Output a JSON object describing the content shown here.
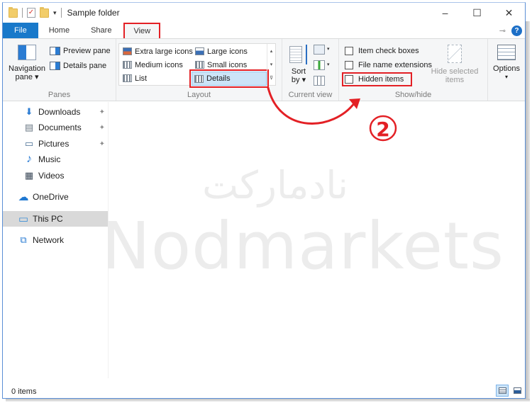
{
  "window": {
    "title": "Sample folder",
    "controls": {
      "minimize": "–",
      "maximize": "☐",
      "close": "✕"
    }
  },
  "quick_access_toolbar": {
    "icons": [
      "folder-icon",
      "properties-icon",
      "new-folder-icon",
      "customize-dropdown-icon"
    ],
    "dropdown_glyph": "▾"
  },
  "tabs": [
    {
      "label": "File",
      "active": false
    },
    {
      "label": "Home",
      "active": false
    },
    {
      "label": "Share",
      "active": false
    },
    {
      "label": "View",
      "active": true
    }
  ],
  "tab_right": {
    "pin_glyph": "⊸",
    "help_glyph": "?"
  },
  "ribbon": {
    "panes": {
      "label": "Panes",
      "navigation_pane": "Navigation pane",
      "navigation_pane_line1": "Navigation",
      "navigation_pane_line2": "pane ▾",
      "preview_pane": "Preview pane",
      "details_pane": "Details pane"
    },
    "layout": {
      "label": "Layout",
      "items": [
        {
          "label": "Extra large icons",
          "selected": false
        },
        {
          "label": "Large icons",
          "selected": false
        },
        {
          "label": "Medium icons",
          "selected": false
        },
        {
          "label": "Small icons",
          "selected": false
        },
        {
          "label": "List",
          "selected": false
        },
        {
          "label": "Details",
          "selected": true
        }
      ],
      "scroll_up": "▴",
      "scroll_down": "▾",
      "expand": "⊽"
    },
    "current_view": {
      "label": "Current view",
      "sort_line1": "Sort",
      "sort_line2": "by ▾",
      "dd": "▾"
    },
    "show_hide": {
      "label": "Show/hide",
      "checkboxes": [
        {
          "label": "Item check boxes",
          "checked": false
        },
        {
          "label": "File name extensions",
          "checked": false
        },
        {
          "label": "Hidden items",
          "checked": false
        }
      ],
      "hide_selected_line1": "Hide selected",
      "hide_selected_line2": "items"
    },
    "options": {
      "label": "Options",
      "dd": "▾"
    }
  },
  "navigation": {
    "items": [
      {
        "label": "Downloads",
        "icon": "downloads-icon",
        "glyph": "⬇",
        "color": "#2b7cd3",
        "pinned": true
      },
      {
        "label": "Documents",
        "icon": "documents-icon",
        "glyph": "▤",
        "color": "#6b7885",
        "pinned": true
      },
      {
        "label": "Pictures",
        "icon": "pictures-icon",
        "glyph": "▭",
        "color": "#4a6f95",
        "pinned": true
      },
      {
        "label": "Music",
        "icon": "music-icon",
        "glyph": "♪",
        "color": "#2b7cd3",
        "pinned": false
      },
      {
        "label": "Videos",
        "icon": "videos-icon",
        "glyph": "▦",
        "color": "#3d4a5a",
        "pinned": false
      },
      {
        "label": "OneDrive",
        "icon": "onedrive-icon",
        "glyph": "☁",
        "color": "#1f78d1",
        "pinned": false
      },
      {
        "label": "This PC",
        "icon": "this-pc-icon",
        "glyph": "▭",
        "color": "#3c8fd8",
        "pinned": false,
        "selected": true
      },
      {
        "label": "Network",
        "icon": "network-icon",
        "glyph": "⧉",
        "color": "#2b7cd3",
        "pinned": false
      }
    ],
    "pin_glyph": "📌"
  },
  "watermark": {
    "persian": "نادمارکت",
    "latin": "Nodmarkets"
  },
  "annotation": {
    "step_number": "2",
    "color": "#e32025"
  },
  "status": {
    "item_count": "0 items"
  },
  "view_buttons": [
    {
      "name": "details-view",
      "active": true
    },
    {
      "name": "large-icons-view",
      "active": false
    }
  ],
  "colors": {
    "accent": "#1979ca",
    "highlight": "#e32025",
    "selection": "#cce4f7"
  }
}
